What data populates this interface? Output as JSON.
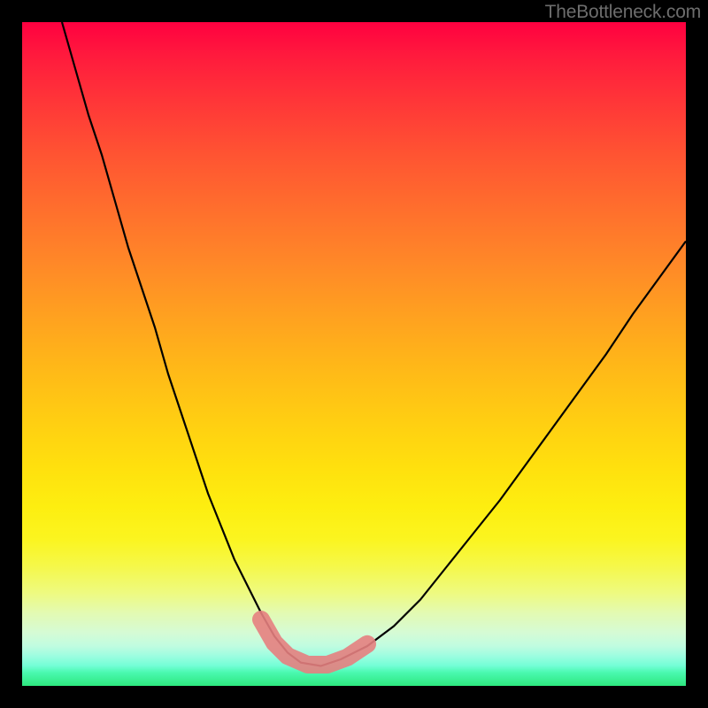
{
  "watermark": "TheBottleneck.com",
  "chart_data": {
    "type": "line",
    "title": "",
    "xlabel": "",
    "ylabel": "",
    "xlim": [
      0,
      100
    ],
    "ylim": [
      0,
      100
    ],
    "grid": false,
    "series": [
      {
        "name": "bottleneck-curve",
        "x": [
          6,
          8,
          10,
          12,
          14,
          16,
          18,
          20,
          22,
          24,
          26,
          28,
          30,
          32,
          34,
          36,
          38,
          40,
          42,
          45,
          48,
          52,
          56,
          60,
          64,
          68,
          72,
          76,
          80,
          84,
          88,
          92,
          96,
          100
        ],
        "y": [
          100,
          93,
          86,
          80,
          73,
          66,
          60,
          54,
          47,
          41,
          35,
          29,
          24,
          19,
          15,
          11,
          7.5,
          5,
          3.5,
          3,
          4,
          6,
          9,
          13,
          18,
          23,
          28,
          33.5,
          39,
          44.5,
          50,
          56,
          61.5,
          67
        ],
        "color": "#000000"
      }
    ],
    "annotations": [
      {
        "name": "trough-highlight",
        "x": [
          36,
          38,
          40,
          43,
          46,
          49,
          52
        ],
        "y": [
          10,
          6.5,
          4.5,
          3.2,
          3.2,
          4.3,
          6.3
        ],
        "color": "#e68080"
      }
    ],
    "background_gradient": {
      "top": "#ff0040",
      "mid": "#ffe00e",
      "bottom": "#2de77e"
    }
  }
}
